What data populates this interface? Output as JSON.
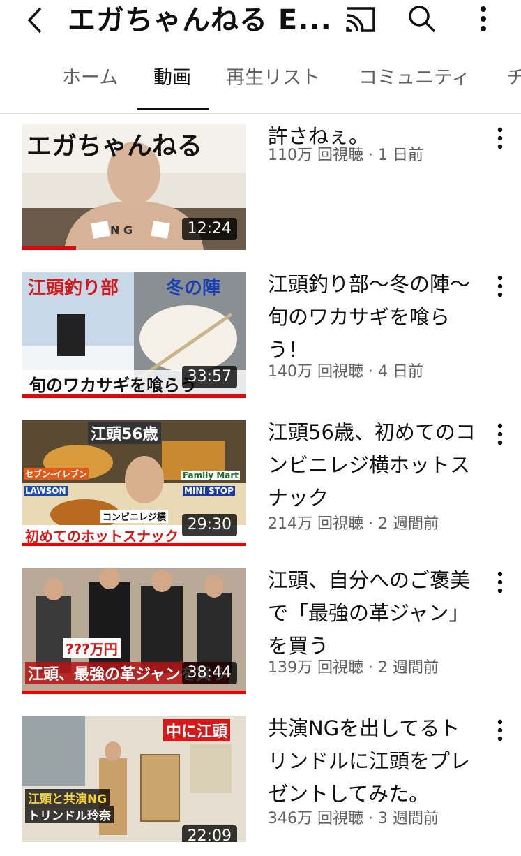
{
  "header": {
    "title": "エガちゃんねる E...",
    "back_icon": "arrow-back-icon",
    "cast_icon": "cast-icon",
    "search_icon": "search-icon",
    "menu_icon": "more-vert-icon"
  },
  "tabs": [
    {
      "label": "ホーム"
    },
    {
      "label": "動画"
    },
    {
      "label": "再生リスト"
    },
    {
      "label": "コミュニティ"
    },
    {
      "label": "チ"
    }
  ],
  "active_tab": "動画",
  "colors": {
    "progress": "#ee0000",
    "text_primary": "#0f0f0f",
    "text_secondary": "#606060"
  },
  "videos": [
    {
      "title": "許さねぇ。",
      "views": "110万 回視聴",
      "age": "1 日前",
      "duration": "12:24",
      "thumb_text": [
        "エガちゃんねる",
        "N G"
      ],
      "watched_fraction": 0.24
    },
    {
      "title": "江頭釣り部〜冬の陣〜　旬のワカサギを喰らう！",
      "views": "140万 回視聴",
      "age": "4 日前",
      "duration": "33:57",
      "thumb_text": [
        "江頭釣り部",
        "冬の陣",
        "旬のワカサギを喰らう"
      ],
      "watched_fraction": 1.0
    },
    {
      "title": "江頭56歳、初めてのコンビニレジ横ホットスナック",
      "views": "214万 回視聴",
      "age": "2 週間前",
      "duration": "29:30",
      "thumb_text": [
        "江頭56歳",
        "セブン-イレブン",
        "Family Mart",
        "LAWSON",
        "MINI STOP",
        "コンビニレジ横",
        "初めてのホットスナック"
      ],
      "watched_fraction": 1.0
    },
    {
      "title": "江頭、自分へのご褒美で「最強の革ジャン」を買う",
      "views": "139万 回視聴",
      "age": "2 週間前",
      "duration": "38:44",
      "thumb_text": [
        "???万円",
        "江頭、最強の革ジャンを買う"
      ],
      "watched_fraction": 1.0
    },
    {
      "title": "共演NGを出してるトリンドルに江頭をプレゼントしてみた。",
      "views": "346万 回視聴",
      "age": "3 週間前",
      "duration": "22:09",
      "thumb_text": [
        "中に江頭",
        "江頭と共演NG",
        "トリンドル玲奈"
      ],
      "watched_fraction": 0.0
    }
  ]
}
